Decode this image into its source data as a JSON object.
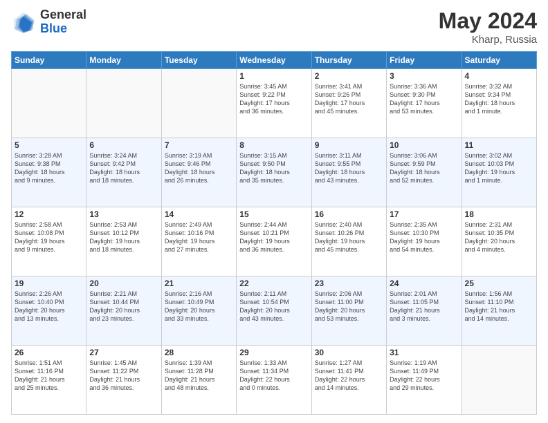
{
  "header": {
    "logo_general": "General",
    "logo_blue": "Blue",
    "month": "May 2024",
    "location": "Kharp, Russia"
  },
  "days_of_week": [
    "Sunday",
    "Monday",
    "Tuesday",
    "Wednesday",
    "Thursday",
    "Friday",
    "Saturday"
  ],
  "weeks": [
    [
      {
        "day": "",
        "info": ""
      },
      {
        "day": "",
        "info": ""
      },
      {
        "day": "",
        "info": ""
      },
      {
        "day": "1",
        "info": "Sunrise: 3:45 AM\nSunset: 9:22 PM\nDaylight: 17 hours\nand 36 minutes."
      },
      {
        "day": "2",
        "info": "Sunrise: 3:41 AM\nSunset: 9:26 PM\nDaylight: 17 hours\nand 45 minutes."
      },
      {
        "day": "3",
        "info": "Sunrise: 3:36 AM\nSunset: 9:30 PM\nDaylight: 17 hours\nand 53 minutes."
      },
      {
        "day": "4",
        "info": "Sunrise: 3:32 AM\nSunset: 9:34 PM\nDaylight: 18 hours\nand 1 minute."
      }
    ],
    [
      {
        "day": "5",
        "info": "Sunrise: 3:28 AM\nSunset: 9:38 PM\nDaylight: 18 hours\nand 9 minutes."
      },
      {
        "day": "6",
        "info": "Sunrise: 3:24 AM\nSunset: 9:42 PM\nDaylight: 18 hours\nand 18 minutes."
      },
      {
        "day": "7",
        "info": "Sunrise: 3:19 AM\nSunset: 9:46 PM\nDaylight: 18 hours\nand 26 minutes."
      },
      {
        "day": "8",
        "info": "Sunrise: 3:15 AM\nSunset: 9:50 PM\nDaylight: 18 hours\nand 35 minutes."
      },
      {
        "day": "9",
        "info": "Sunrise: 3:11 AM\nSunset: 9:55 PM\nDaylight: 18 hours\nand 43 minutes."
      },
      {
        "day": "10",
        "info": "Sunrise: 3:06 AM\nSunset: 9:59 PM\nDaylight: 18 hours\nand 52 minutes."
      },
      {
        "day": "11",
        "info": "Sunrise: 3:02 AM\nSunset: 10:03 PM\nDaylight: 19 hours\nand 1 minute."
      }
    ],
    [
      {
        "day": "12",
        "info": "Sunrise: 2:58 AM\nSunset: 10:08 PM\nDaylight: 19 hours\nand 9 minutes."
      },
      {
        "day": "13",
        "info": "Sunrise: 2:53 AM\nSunset: 10:12 PM\nDaylight: 19 hours\nand 18 minutes."
      },
      {
        "day": "14",
        "info": "Sunrise: 2:49 AM\nSunset: 10:16 PM\nDaylight: 19 hours\nand 27 minutes."
      },
      {
        "day": "15",
        "info": "Sunrise: 2:44 AM\nSunset: 10:21 PM\nDaylight: 19 hours\nand 36 minutes."
      },
      {
        "day": "16",
        "info": "Sunrise: 2:40 AM\nSunset: 10:26 PM\nDaylight: 19 hours\nand 45 minutes."
      },
      {
        "day": "17",
        "info": "Sunrise: 2:35 AM\nSunset: 10:30 PM\nDaylight: 19 hours\nand 54 minutes."
      },
      {
        "day": "18",
        "info": "Sunrise: 2:31 AM\nSunset: 10:35 PM\nDaylight: 20 hours\nand 4 minutes."
      }
    ],
    [
      {
        "day": "19",
        "info": "Sunrise: 2:26 AM\nSunset: 10:40 PM\nDaylight: 20 hours\nand 13 minutes."
      },
      {
        "day": "20",
        "info": "Sunrise: 2:21 AM\nSunset: 10:44 PM\nDaylight: 20 hours\nand 23 minutes."
      },
      {
        "day": "21",
        "info": "Sunrise: 2:16 AM\nSunset: 10:49 PM\nDaylight: 20 hours\nand 33 minutes."
      },
      {
        "day": "22",
        "info": "Sunrise: 2:11 AM\nSunset: 10:54 PM\nDaylight: 20 hours\nand 43 minutes."
      },
      {
        "day": "23",
        "info": "Sunrise: 2:06 AM\nSunset: 11:00 PM\nDaylight: 20 hours\nand 53 minutes."
      },
      {
        "day": "24",
        "info": "Sunrise: 2:01 AM\nSunset: 11:05 PM\nDaylight: 21 hours\nand 3 minutes."
      },
      {
        "day": "25",
        "info": "Sunrise: 1:56 AM\nSunset: 11:10 PM\nDaylight: 21 hours\nand 14 minutes."
      }
    ],
    [
      {
        "day": "26",
        "info": "Sunrise: 1:51 AM\nSunset: 11:16 PM\nDaylight: 21 hours\nand 25 minutes."
      },
      {
        "day": "27",
        "info": "Sunrise: 1:45 AM\nSunset: 11:22 PM\nDaylight: 21 hours\nand 36 minutes."
      },
      {
        "day": "28",
        "info": "Sunrise: 1:39 AM\nSunset: 11:28 PM\nDaylight: 21 hours\nand 48 minutes."
      },
      {
        "day": "29",
        "info": "Sunrise: 1:33 AM\nSunset: 11:34 PM\nDaylight: 22 hours\nand 0 minutes."
      },
      {
        "day": "30",
        "info": "Sunrise: 1:27 AM\nSunset: 11:41 PM\nDaylight: 22 hours\nand 14 minutes."
      },
      {
        "day": "31",
        "info": "Sunrise: 1:19 AM\nSunset: 11:49 PM\nDaylight: 22 hours\nand 29 minutes."
      },
      {
        "day": "",
        "info": ""
      }
    ]
  ]
}
